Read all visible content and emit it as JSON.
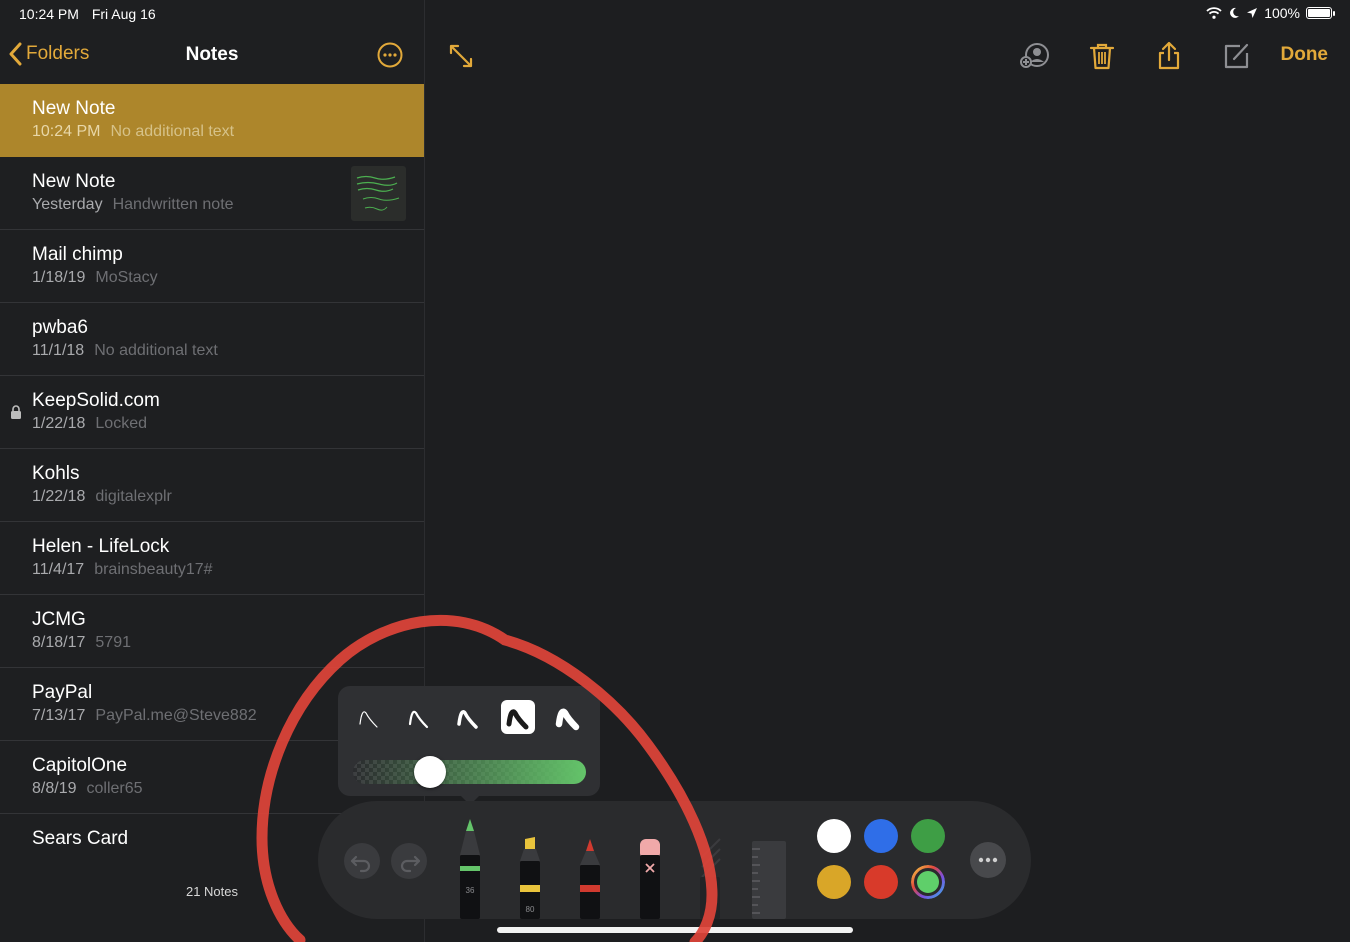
{
  "status_bar": {
    "time": "10:24 PM",
    "date": "Fri Aug 16",
    "battery": "100%"
  },
  "sidebar": {
    "back_label": "Folders",
    "title": "Notes",
    "notes": [
      {
        "title": "New Note",
        "date": "10:24 PM",
        "preview": "No additional text",
        "selected": true
      },
      {
        "title": "New Note",
        "date": "Yesterday",
        "preview": "Handwritten note",
        "has_thumbnail": true
      },
      {
        "title": "Mail chimp",
        "date": "1/18/19",
        "preview": "MoStacy"
      },
      {
        "title": "pwba6",
        "date": "11/1/18",
        "preview": "No additional text"
      },
      {
        "title": "KeepSolid.com",
        "date": "1/22/18",
        "preview": "Locked",
        "locked": true
      },
      {
        "title": "Kohls",
        "date": "1/22/18",
        "preview": "digitalexplr"
      },
      {
        "title": "Helen - LifeLock",
        "date": "11/4/17",
        "preview": "brainsbeauty17#"
      },
      {
        "title": "JCMG",
        "date": "8/18/17",
        "preview": "5791"
      },
      {
        "title": "PayPal",
        "date": "7/13/17",
        "preview": "PayPal.me@Steve882"
      },
      {
        "title": "CapitolOne",
        "date": "8/8/19",
        "preview": "coller65"
      },
      {
        "title": "Sears Card",
        "date": "",
        "preview": ""
      }
    ],
    "count_label": "21 Notes"
  },
  "editor_toolbar": {
    "icons": [
      "expand-icon",
      "collaborate-icon",
      "trash-icon",
      "share-icon",
      "compose-icon"
    ],
    "done_label": "Done"
  },
  "pen_popup": {
    "thickness_options": 5,
    "selected_thickness_index": 3,
    "opacity": 0.33,
    "accent": "#64c46a"
  },
  "markup_toolbar": {
    "tools": [
      {
        "name": "pen",
        "size_label": "36",
        "color": "#64c46a",
        "selected": true
      },
      {
        "name": "marker",
        "size_label": "80",
        "color": "#e8c33c"
      },
      {
        "name": "pencil",
        "size_label": "",
        "color": "#d03a2f"
      },
      {
        "name": "eraser",
        "size_label": "",
        "color": "#f0a9a9"
      }
    ],
    "colors": [
      "#ffffff",
      "#2f6ee8",
      "#3e9e45",
      "#d9a628",
      "#d83a2a",
      "#5fcf6a"
    ]
  },
  "annotation": {
    "color": "#e0443a"
  }
}
